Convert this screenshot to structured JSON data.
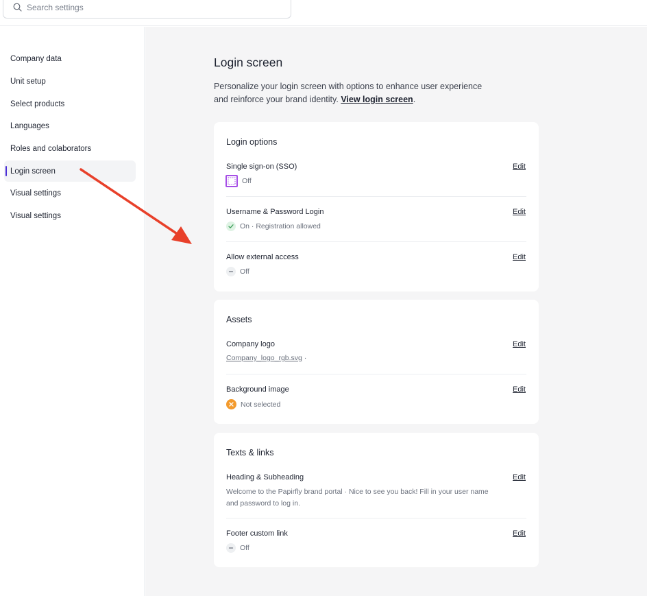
{
  "search": {
    "placeholder": "Search settings"
  },
  "sidebar": {
    "items": [
      {
        "label": "Company data"
      },
      {
        "label": "Unit setup"
      },
      {
        "label": "Select products"
      },
      {
        "label": "Languages"
      },
      {
        "label": "Roles and colaborators"
      },
      {
        "label": "Login screen",
        "active": true
      },
      {
        "label": "Visual settings"
      },
      {
        "label": "Visual settings"
      }
    ]
  },
  "page": {
    "title": "Login screen",
    "description": "Personalize your login screen with options to enhance user experience and reinforce your brand identity.",
    "link": "View login screen"
  },
  "sections": {
    "login_options": {
      "title": "Login options",
      "rows": [
        {
          "label": "Single sign-on (SSO)",
          "status": "Off",
          "edit": "Edit",
          "icon": "sso-dotted-icon"
        },
        {
          "label": "Username & Password Login",
          "status": "On · Registration allowed",
          "edit": "Edit",
          "icon": "check-icon"
        },
        {
          "label": "Allow external access",
          "status": "Off",
          "edit": "Edit",
          "icon": "dash-icon"
        }
      ]
    },
    "assets": {
      "title": "Assets",
      "rows": [
        {
          "label": "Company logo",
          "file": "Company_logo_rgb.svg",
          "suffix": " ·",
          "edit": "Edit"
        },
        {
          "label": "Background image",
          "status": "Not selected",
          "edit": "Edit",
          "icon": "x-icon"
        }
      ]
    },
    "texts_links": {
      "title": "Texts & links",
      "rows": [
        {
          "label": "Heading & Subheading",
          "sub": "Welcome to the Papirfly brand portal  · Nice to see you back! Fill in your user name and password to log in.",
          "edit": "Edit"
        },
        {
          "label": "Footer custom link",
          "status": "Off",
          "edit": "Edit",
          "icon": "dash-icon"
        }
      ]
    }
  },
  "colors": {
    "accent": "#4b2fd6",
    "annotation_arrow": "#e8402a",
    "warning": "#f39a2d",
    "success": "#3a9d57"
  }
}
